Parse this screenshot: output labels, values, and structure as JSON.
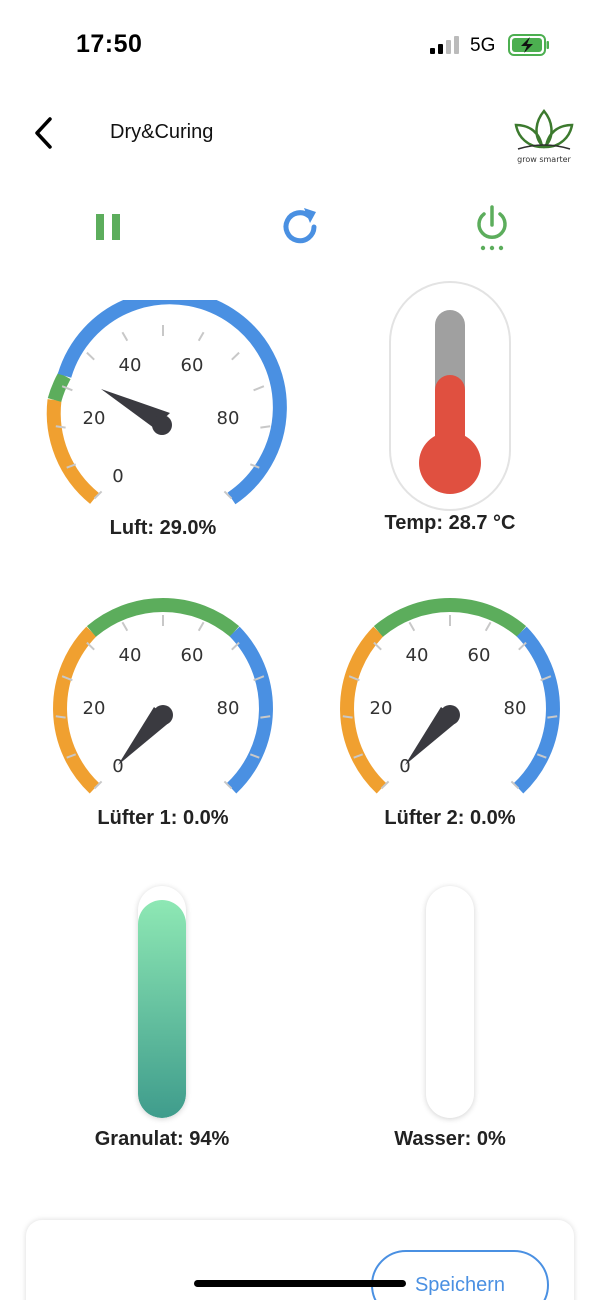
{
  "status_bar": {
    "time": "17:50",
    "network": "5G"
  },
  "nav": {
    "title": "Dry&Curing",
    "logo_text": "grow smarter"
  },
  "gauges": {
    "luft": {
      "label": "Luft: 29.0%",
      "value": 29.0,
      "ticks": [
        "0",
        "20",
        "40",
        "60",
        "80"
      ]
    },
    "luefter1": {
      "label": "Lüfter 1: 0.0%",
      "value": 0.0,
      "ticks": [
        "0",
        "20",
        "40",
        "60",
        "80"
      ]
    },
    "luefter2": {
      "label": "Lüfter 2: 0.0%",
      "value": 0.0,
      "ticks": [
        "0",
        "20",
        "40",
        "60",
        "80"
      ]
    }
  },
  "thermometer": {
    "label": "Temp: 28.7 °C",
    "level_percent": 55
  },
  "tanks": {
    "granulat": {
      "label": "Granulat: 94%",
      "value_percent": 94
    },
    "wasser": {
      "label": "Wasser: 0%",
      "value_percent": 0
    }
  },
  "bottom": {
    "save_label": "Speichern"
  },
  "colors": {
    "blue": "#4a90e2",
    "orange": "#f0a030",
    "green": "#5cad5c",
    "needle": "#3a3a40",
    "thermo_red": "#e05040",
    "thermo_grey": "#a0a0a0"
  }
}
